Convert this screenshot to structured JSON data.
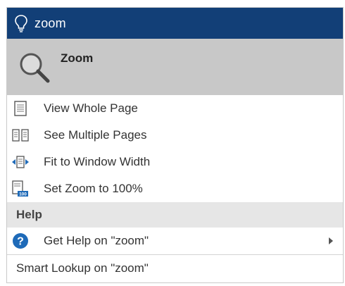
{
  "search": {
    "query": "zoom",
    "bulb_icon": "lightbulb-icon"
  },
  "zoom_item": {
    "label": "Zoom",
    "icon": "magnifier-icon"
  },
  "commands": [
    {
      "label": "View Whole Page",
      "icon": "page-icon"
    },
    {
      "label": "See Multiple Pages",
      "icon": "multiple-pages-icon"
    },
    {
      "label": "Fit to Window Width",
      "icon": "fit-width-icon"
    },
    {
      "label": "Set Zoom to 100%",
      "icon": "zoom-100-icon",
      "icon_text": "100"
    }
  ],
  "help": {
    "header": "Help",
    "get_help_label": "Get Help on \"zoom\"",
    "help_icon": "help-icon"
  },
  "smart_lookup": {
    "label": "Smart Lookup on \"zoom\""
  },
  "colors": {
    "title_bar": "#123f77",
    "zoom_highlight": "#c8c8c8",
    "section_header": "#e6e6e6",
    "help_blue": "#1e6ab8"
  }
}
